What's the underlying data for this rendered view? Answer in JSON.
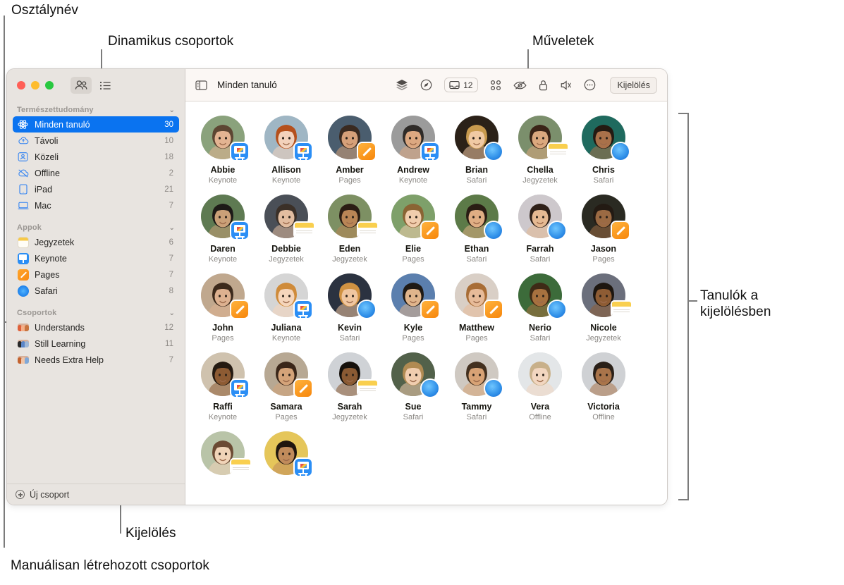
{
  "annotations": [
    {
      "key": "class_name",
      "text": "Osztálynév"
    },
    {
      "key": "dynamic_groups",
      "text": "Dinamikus csoportok"
    },
    {
      "key": "actions",
      "text": "Műveletek"
    },
    {
      "key": "students_in_selection",
      "text": "Tanulók a\nkijelölésben"
    },
    {
      "key": "selection",
      "text": "Kijelölés"
    },
    {
      "key": "manual_groups",
      "text": "Manuálisan létrehozott csoportok"
    }
  ],
  "window": {
    "titlebar": {
      "view_people_icon": "people-icon",
      "view_list_icon": "list-icon"
    },
    "sidebar": {
      "sections": [
        {
          "title": "Természettudomány",
          "collapse_icon": "chevron-down-icon",
          "items": [
            {
              "label": "Minden tanuló",
              "count": "30",
              "icon": "atom-icon",
              "selected": true
            },
            {
              "label": "Távoli",
              "count": "10",
              "icon": "cloud-icon",
              "selected": false
            },
            {
              "label": "Közeli",
              "count": "18",
              "icon": "person-badge-icon",
              "selected": false
            },
            {
              "label": "Offline",
              "count": "2",
              "icon": "cloud-slash-icon",
              "selected": false
            },
            {
              "label": "iPad",
              "count": "21",
              "icon": "ipad-icon",
              "selected": false
            },
            {
              "label": "Mac",
              "count": "7",
              "icon": "mac-icon",
              "selected": false
            }
          ]
        },
        {
          "title": "Appok",
          "collapse_icon": "chevron-down-icon",
          "items": [
            {
              "label": "Jegyzetek",
              "count": "6",
              "icon": "notes-app-icon",
              "selected": false
            },
            {
              "label": "Keynote",
              "count": "7",
              "icon": "keynote-app-icon",
              "selected": false
            },
            {
              "label": "Pages",
              "count": "7",
              "icon": "pages-app-icon",
              "selected": false
            },
            {
              "label": "Safari",
              "count": "8",
              "icon": "safari-app-icon",
              "selected": false
            }
          ]
        },
        {
          "title": "Csoportok",
          "collapse_icon": "chevron-down-icon",
          "items": [
            {
              "label": "Understands",
              "count": "12",
              "icon": "group-icon",
              "selected": false
            },
            {
              "label": "Still Learning",
              "count": "11",
              "icon": "group-icon",
              "selected": false
            },
            {
              "label": "Needs Extra Help",
              "count": "7",
              "icon": "group-icon",
              "selected": false
            }
          ]
        }
      ],
      "footer": {
        "label": "Új csoport",
        "icon": "plus-circle-icon"
      }
    },
    "toolbar": {
      "sidebar_toggle_icon": "sidebar-toggle-icon",
      "title": "Minden tanuló",
      "actions": [
        {
          "name": "layers-icon",
          "label": ""
        },
        {
          "name": "navigate-compass-icon",
          "label": ""
        },
        {
          "name": "inbox-icon",
          "label": "12"
        },
        {
          "name": "apps-grid-icon",
          "label": ""
        },
        {
          "name": "hide-screen-eye-icon",
          "label": ""
        },
        {
          "name": "lock-icon",
          "label": ""
        },
        {
          "name": "mute-icon",
          "label": ""
        },
        {
          "name": "more-ellipsis-icon",
          "label": ""
        }
      ],
      "select_button": "Kijelölés"
    },
    "students": [
      {
        "name": "Abbie",
        "app": "Keynote",
        "badge": "keynote",
        "hair": "#5d4632",
        "skin": "#e3b492",
        "bg": "#8aa27c"
      },
      {
        "name": "Allison",
        "app": "Keynote",
        "badge": "keynote",
        "hair": "#b5501c",
        "skin": "#f3d2bc",
        "bg": "#9fb6c4"
      },
      {
        "name": "Amber",
        "app": "Pages",
        "badge": "pages",
        "hair": "#3a2a20",
        "skin": "#d6a079",
        "bg": "#4a5d6e"
      },
      {
        "name": "Andrew",
        "app": "Keynote",
        "badge": "keynote",
        "hair": "#2f2b28",
        "skin": "#dca881",
        "bg": "#9b9b9b"
      },
      {
        "name": "Brian",
        "app": "Safari",
        "badge": "safari",
        "hair": "#c89a4e",
        "skin": "#f0c9a4",
        "bg": "#2b2118"
      },
      {
        "name": "Chella",
        "app": "Jegyzetek",
        "badge": "notes",
        "hair": "#3a2417",
        "skin": "#dba87e",
        "bg": "#7b8f6c"
      },
      {
        "name": "Chris",
        "app": "Safari",
        "badge": "safari",
        "hair": "#241a12",
        "skin": "#a9714a",
        "bg": "#1f6a5e"
      },
      {
        "name": "Daren",
        "app": "Keynote",
        "badge": "keynote",
        "hair": "#1d1a17",
        "skin": "#caa078",
        "bg": "#5e7a52"
      },
      {
        "name": "Debbie",
        "app": "Jegyzetek",
        "badge": "notes",
        "hair": "#3b3028",
        "skin": "#e2bda0",
        "bg": "#4a4f57"
      },
      {
        "name": "Eden",
        "app": "Jegyzetek",
        "badge": "notes",
        "hair": "#2b1d14",
        "skin": "#b98556",
        "bg": "#7d9063"
      },
      {
        "name": "Elie",
        "app": "Pages",
        "badge": "pages",
        "hair": "#8a6434",
        "skin": "#f0cdad",
        "bg": "#7ea06a"
      },
      {
        "name": "Ethan",
        "app": "Safari",
        "badge": "safari",
        "hair": "#2a1d14",
        "skin": "#dfae84",
        "bg": "#5c7a48"
      },
      {
        "name": "Farrah",
        "app": "Safari",
        "badge": "safari",
        "hair": "#2e2018",
        "skin": "#e5b992",
        "bg": "#cdc8cc"
      },
      {
        "name": "Jason",
        "app": "Pages",
        "badge": "pages",
        "hair": "#231a13",
        "skin": "#9b6a43",
        "bg": "#2a2a22"
      },
      {
        "name": "John",
        "app": "Pages",
        "badge": "pages",
        "hair": "#3c2a1c",
        "skin": "#ddb190",
        "bg": "#c0a88e"
      },
      {
        "name": "Juliana",
        "app": "Keynote",
        "badge": "keynote",
        "hair": "#cf8b3a",
        "skin": "#f5d5bb",
        "bg": "#d5d5d5"
      },
      {
        "name": "Kevin",
        "app": "Safari",
        "badge": "safari",
        "hair": "#d09242",
        "skin": "#f0c6a0",
        "bg": "#2b3240"
      },
      {
        "name": "Kyle",
        "app": "Pages",
        "badge": "pages",
        "hair": "#1f1a15",
        "skin": "#e0b58c",
        "bg": "#5b7fae"
      },
      {
        "name": "Matthew",
        "app": "Pages",
        "badge": "pages",
        "hair": "#a86d36",
        "skin": "#e7bb99",
        "bg": "#d9cfc6"
      },
      {
        "name": "Nerio",
        "app": "Safari",
        "badge": "safari",
        "hair": "#3e2a16",
        "skin": "#a7713f",
        "bg": "#3c6b3a"
      },
      {
        "name": "Nicole",
        "app": "Jegyzetek",
        "badge": "notes",
        "hair": "#1d1610",
        "skin": "#8e5c34",
        "bg": "#6b6f7c"
      },
      {
        "name": "Raffi",
        "app": "Keynote",
        "badge": "keynote",
        "hair": "#241a11",
        "skin": "#8d5b33",
        "bg": "#cfc2ae"
      },
      {
        "name": "Samara",
        "app": "Pages",
        "badge": "pages",
        "hair": "#3a2619",
        "skin": "#d4a379",
        "bg": "#b7a893"
      },
      {
        "name": "Sarah",
        "app": "Jegyzetek",
        "badge": "notes",
        "hair": "#15100b",
        "skin": "#8a5a33",
        "bg": "#cfd2d6"
      },
      {
        "name": "Sue",
        "app": "Safari",
        "badge": "safari",
        "hair": "#b08a52",
        "skin": "#f0cdaf",
        "bg": "#52614a"
      },
      {
        "name": "Tammy",
        "app": "Safari",
        "badge": "safari",
        "hair": "#43301f",
        "skin": "#d7a275",
        "bg": "#cfc9c2"
      },
      {
        "name": "Vera",
        "app": "Offline",
        "badge": "none",
        "hair": "#c8b08a",
        "skin": "#f2d6c0",
        "bg": "#e3e6e8"
      },
      {
        "name": "Victoria",
        "app": "Offline",
        "badge": "none",
        "hair": "#2a2018",
        "skin": "#a9744a",
        "bg": "#cfd1d4"
      },
      {
        "name": "",
        "app": "",
        "badge": "notes",
        "hair": "#6b4a33",
        "skin": "#f0d4b8",
        "bg": "#b9c4a8"
      },
      {
        "name": "",
        "app": "",
        "badge": "keynote",
        "hair": "#1f160f",
        "skin": "#c08b5b",
        "bg": "#e5c65a"
      }
    ]
  }
}
